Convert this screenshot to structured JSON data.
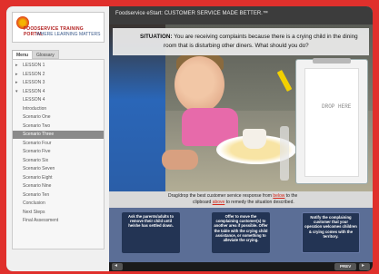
{
  "header": {
    "title": "Foodservice eStart: CUSTOMER SERVICE MADE BETTER.™"
  },
  "logo": {
    "line1": "FOODSERVICE TRAINING PORTAL",
    "line2": "WHERE LEARNING MATTERS"
  },
  "sidebar": {
    "tabs": [
      "Menu",
      "Glossary"
    ],
    "items": [
      {
        "label": "LESSON 1",
        "level": 0
      },
      {
        "label": "LESSON 2",
        "level": 0
      },
      {
        "label": "LESSON 3",
        "level": 0
      },
      {
        "label": "LESSON 4",
        "level": 0
      },
      {
        "label": "LESSON 4",
        "level": 1
      },
      {
        "label": "Introduction",
        "level": 1
      },
      {
        "label": "Scenario One",
        "level": 1
      },
      {
        "label": "Scenario Two",
        "level": 1
      },
      {
        "label": "Scenario Three",
        "level": 1
      },
      {
        "label": "Scenario Four",
        "level": 1
      },
      {
        "label": "Scenario Five",
        "level": 1
      },
      {
        "label": "Scenario Six",
        "level": 1
      },
      {
        "label": "Scenario Seven",
        "level": 1
      },
      {
        "label": "Scenario Eight",
        "level": 1
      },
      {
        "label": "Scenario Nine",
        "level": 1
      },
      {
        "label": "Scenario Ten",
        "level": 1
      },
      {
        "label": "Conclusion",
        "level": 1
      },
      {
        "label": "Next Steps",
        "level": 1
      },
      {
        "label": "Final Assessment",
        "level": 1
      }
    ],
    "active_index": 8
  },
  "situation": {
    "label": "SITUATION:",
    "line1": "You are receiving complaints because there is a crying child in the dining",
    "line2": "room that is disturbing other diners. What should you do?"
  },
  "dropzone": {
    "label": "DROP HERE"
  },
  "instructions": {
    "line1_a": "Drag/drop the best customer service response from ",
    "line1_u": "below",
    "line1_b": " to the",
    "line2_a": "clipboard ",
    "line2_u": "above",
    "line2_b": " to remedy the situation described."
  },
  "cards": [
    "Ask the parents/adults to remove their child until he/she has settled down.",
    "Offer to move the complaining customer(s) to another area if possible. Offer the table with the crying child assistance, or something to alleviate the crying.",
    "Notify the complaining customer that your operation welcomes children & crying comes with the territory."
  ],
  "footer": {
    "prev_label": "PREV",
    "back_icon": "back-arrow-icon",
    "next_icon": "next-arrow-icon"
  },
  "colors": {
    "outer": "#e0302c",
    "frame": "#1a1a1a",
    "card_band": "#5b6e96",
    "card": "#233454",
    "link_red": "#d62a1e"
  }
}
